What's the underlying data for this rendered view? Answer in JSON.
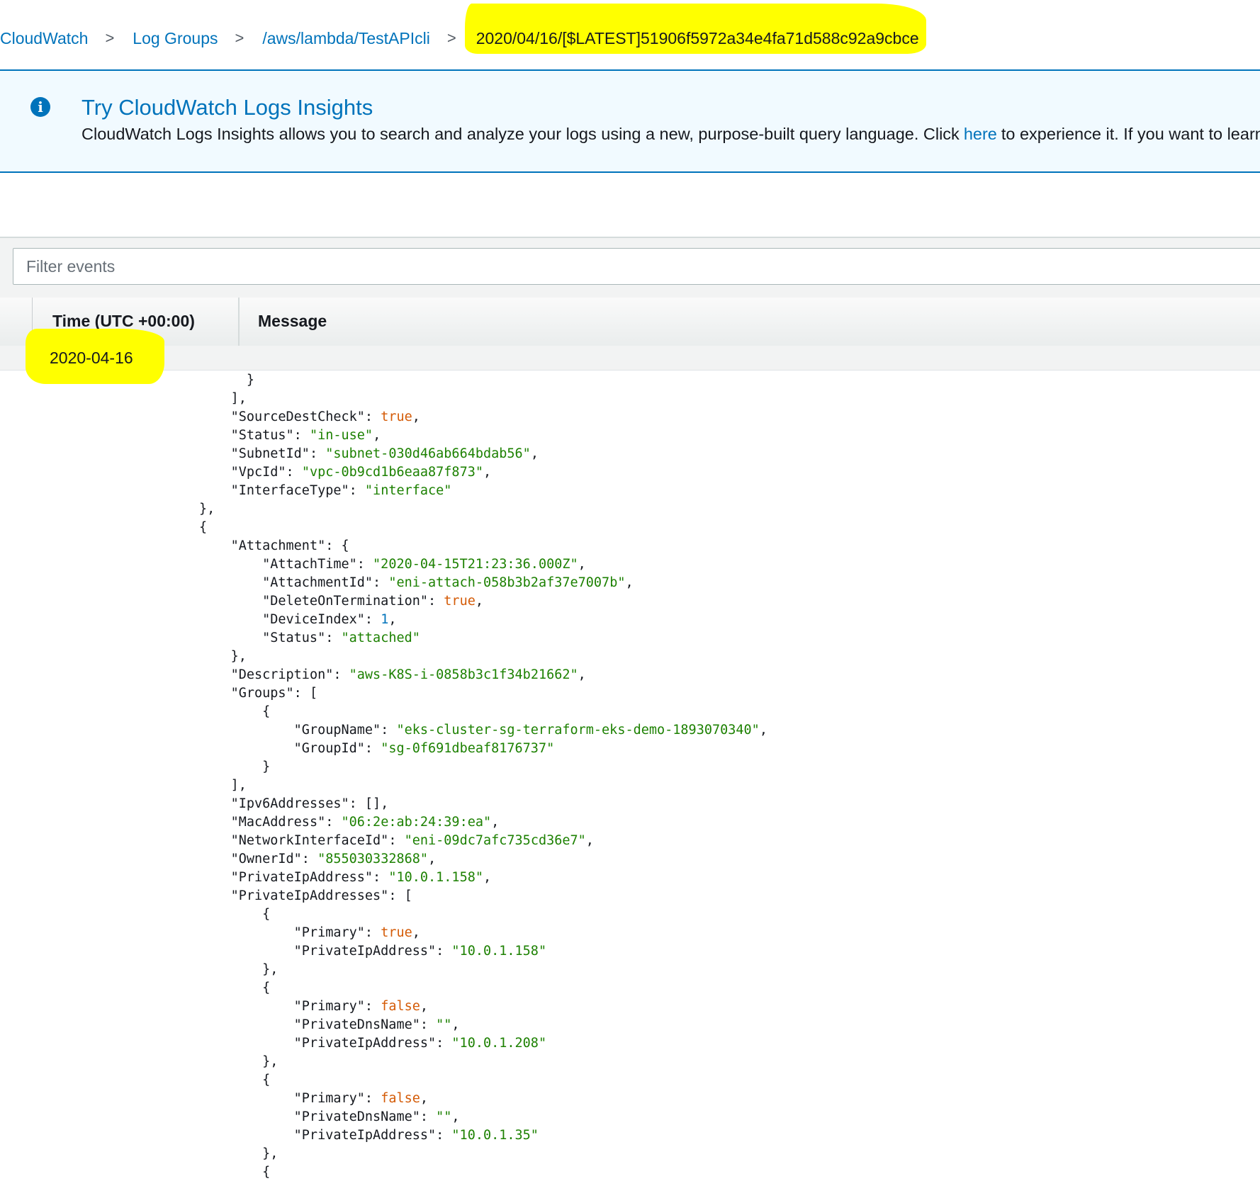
{
  "breadcrumb": {
    "items": [
      "CloudWatch",
      "Log Groups",
      "/aws/lambda/TestAPIcli"
    ],
    "current": "2020/04/16/[$LATEST]51906f5972a34e4fa71d588c92a9cbce",
    "separator": ">"
  },
  "banner": {
    "title": "Try CloudWatch Logs Insights",
    "text_before": "CloudWatch Logs Insights allows you to search and analyze your logs using a new, purpose-built query language. Click",
    "link": "here",
    "text_after": "to experience it. If you want to learn"
  },
  "filter": {
    "placeholder": "Filter events"
  },
  "table": {
    "time_header": "Time (UTC +00:00)",
    "message_header": "Message",
    "date_group": "2020-04-16"
  },
  "message_lines": [
    [
      [
        "    }",
        ""
      ]
    ],
    [
      [
        "],",
        ""
      ]
    ],
    [
      [
        "\"SourceDestCheck\": ",
        ""
      ],
      [
        "true",
        "b"
      ],
      [
        ",",
        ""
      ]
    ],
    [
      [
        "\"Status\": ",
        ""
      ],
      [
        "\"in-use\"",
        "s"
      ],
      [
        ",",
        ""
      ]
    ],
    [
      [
        "\"SubnetId\": ",
        ""
      ],
      [
        "\"subnet-030d46ab664bdab56\"",
        "s"
      ],
      [
        ",",
        ""
      ]
    ],
    [
      [
        "\"VpcId\": ",
        ""
      ],
      [
        "\"vpc-0b9cd1b6eaa87f873\"",
        "s"
      ],
      [
        ",",
        ""
      ]
    ],
    [
      [
        "\"InterfaceType\": ",
        ""
      ],
      [
        "\"interface\"",
        "s"
      ]
    ],
    [
      [
        "},",
        ""
      ]
    ],
    [
      [
        "{",
        ""
      ]
    ],
    [
      [
        "\"Attachment\": {",
        ""
      ]
    ],
    [
      [
        "\"AttachTime\": ",
        ""
      ],
      [
        "\"2020-04-15T21:23:36.000Z\"",
        "s"
      ],
      [
        ",",
        ""
      ]
    ],
    [
      [
        "\"AttachmentId\": ",
        ""
      ],
      [
        "\"eni-attach-058b3b2af37e7007b\"",
        "s"
      ],
      [
        ",",
        ""
      ]
    ],
    [
      [
        "\"DeleteOnTermination\": ",
        ""
      ],
      [
        "true",
        "b"
      ],
      [
        ",",
        ""
      ]
    ],
    [
      [
        "\"DeviceIndex\": ",
        ""
      ],
      [
        "1",
        "n"
      ],
      [
        ",",
        ""
      ]
    ],
    [
      [
        "\"Status\": ",
        ""
      ],
      [
        "\"attached\"",
        "s"
      ]
    ],
    [
      [
        "},",
        ""
      ]
    ],
    [
      [
        "\"Description\": ",
        ""
      ],
      [
        "\"aws-K8S-i-0858b3c1f34b21662\"",
        "s"
      ],
      [
        ",",
        ""
      ]
    ],
    [
      [
        "\"Groups\": [",
        ""
      ]
    ],
    [
      [
        "{",
        ""
      ]
    ],
    [
      [
        "\"GroupName\": ",
        ""
      ],
      [
        "\"eks-cluster-sg-terraform-eks-demo-1893070340\"",
        "s"
      ],
      [
        ",",
        ""
      ]
    ],
    [
      [
        "\"GroupId\": ",
        ""
      ],
      [
        "\"sg-0f691dbeaf8176737\"",
        "s"
      ]
    ],
    [
      [
        "}",
        ""
      ]
    ],
    [
      [
        "],",
        ""
      ]
    ],
    [
      [
        "\"Ipv6Addresses\": [],",
        ""
      ]
    ],
    [
      [
        "\"MacAddress\": ",
        ""
      ],
      [
        "\"06:2e:ab:24:39:ea\"",
        "s"
      ],
      [
        ",",
        ""
      ]
    ],
    [
      [
        "\"NetworkInterfaceId\": ",
        ""
      ],
      [
        "\"eni-09dc7afc735cd36e7\"",
        "s"
      ],
      [
        ",",
        ""
      ]
    ],
    [
      [
        "\"OwnerId\": ",
        ""
      ],
      [
        "\"855030332868\"",
        "s"
      ],
      [
        ",",
        ""
      ]
    ],
    [
      [
        "\"PrivateIpAddress\": ",
        ""
      ],
      [
        "\"10.0.1.158\"",
        "s"
      ],
      [
        ",",
        ""
      ]
    ],
    [
      [
        "\"PrivateIpAddresses\": [",
        ""
      ]
    ],
    [
      [
        "{",
        ""
      ]
    ],
    [
      [
        "\"Primary\": ",
        ""
      ],
      [
        "true",
        "b"
      ],
      [
        ",",
        ""
      ]
    ],
    [
      [
        "\"PrivateIpAddress\": ",
        ""
      ],
      [
        "\"10.0.1.158\"",
        "s"
      ]
    ],
    [
      [
        "},",
        ""
      ]
    ],
    [
      [
        "{",
        ""
      ]
    ],
    [
      [
        "\"Primary\": ",
        ""
      ],
      [
        "false",
        "b"
      ],
      [
        ",",
        ""
      ]
    ],
    [
      [
        "\"PrivateDnsName\": ",
        ""
      ],
      [
        "\"\"",
        "s"
      ],
      [
        ",",
        ""
      ]
    ],
    [
      [
        "\"PrivateIpAddress\": ",
        ""
      ],
      [
        "\"10.0.1.208\"",
        "s"
      ]
    ],
    [
      [
        "},",
        ""
      ]
    ],
    [
      [
        "{",
        ""
      ]
    ],
    [
      [
        "\"Primary\": ",
        ""
      ],
      [
        "false",
        "b"
      ],
      [
        ",",
        ""
      ]
    ],
    [
      [
        "\"PrivateDnsName\": ",
        ""
      ],
      [
        "\"\"",
        "s"
      ],
      [
        ",",
        ""
      ]
    ],
    [
      [
        "\"PrivateIpAddress\": ",
        ""
      ],
      [
        "\"10.0.1.35\"",
        "s"
      ]
    ],
    [
      [
        "},",
        ""
      ]
    ],
    [
      [
        "{",
        ""
      ]
    ]
  ]
}
